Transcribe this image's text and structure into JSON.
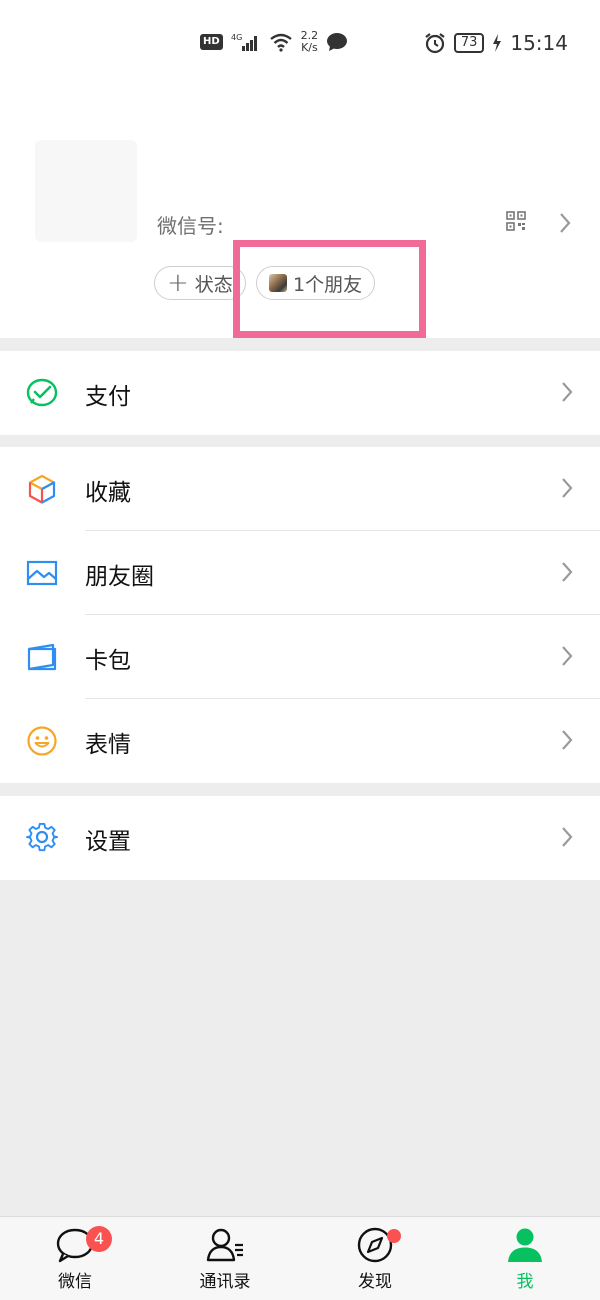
{
  "status_bar": {
    "hd": "HD",
    "signal": "4G",
    "net_speed_value": "2.2",
    "net_speed_unit": "K/s",
    "battery": "73",
    "time": "15:14"
  },
  "profile": {
    "wechat_id_label": "微信号:",
    "status_button": "状态",
    "status_plus": "+",
    "friends_button": "1个朋友"
  },
  "menu": {
    "pay": "支付",
    "favorites": "收藏",
    "moments": "朋友圈",
    "cards": "卡包",
    "stickers": "表情",
    "settings": "设置"
  },
  "tabs": {
    "chats": "微信",
    "chats_badge": "4",
    "contacts": "通讯录",
    "discover": "发现",
    "me": "我"
  },
  "colors": {
    "accent": "#07c160",
    "badge": "#fa5151",
    "highlight": "#f06b97"
  }
}
